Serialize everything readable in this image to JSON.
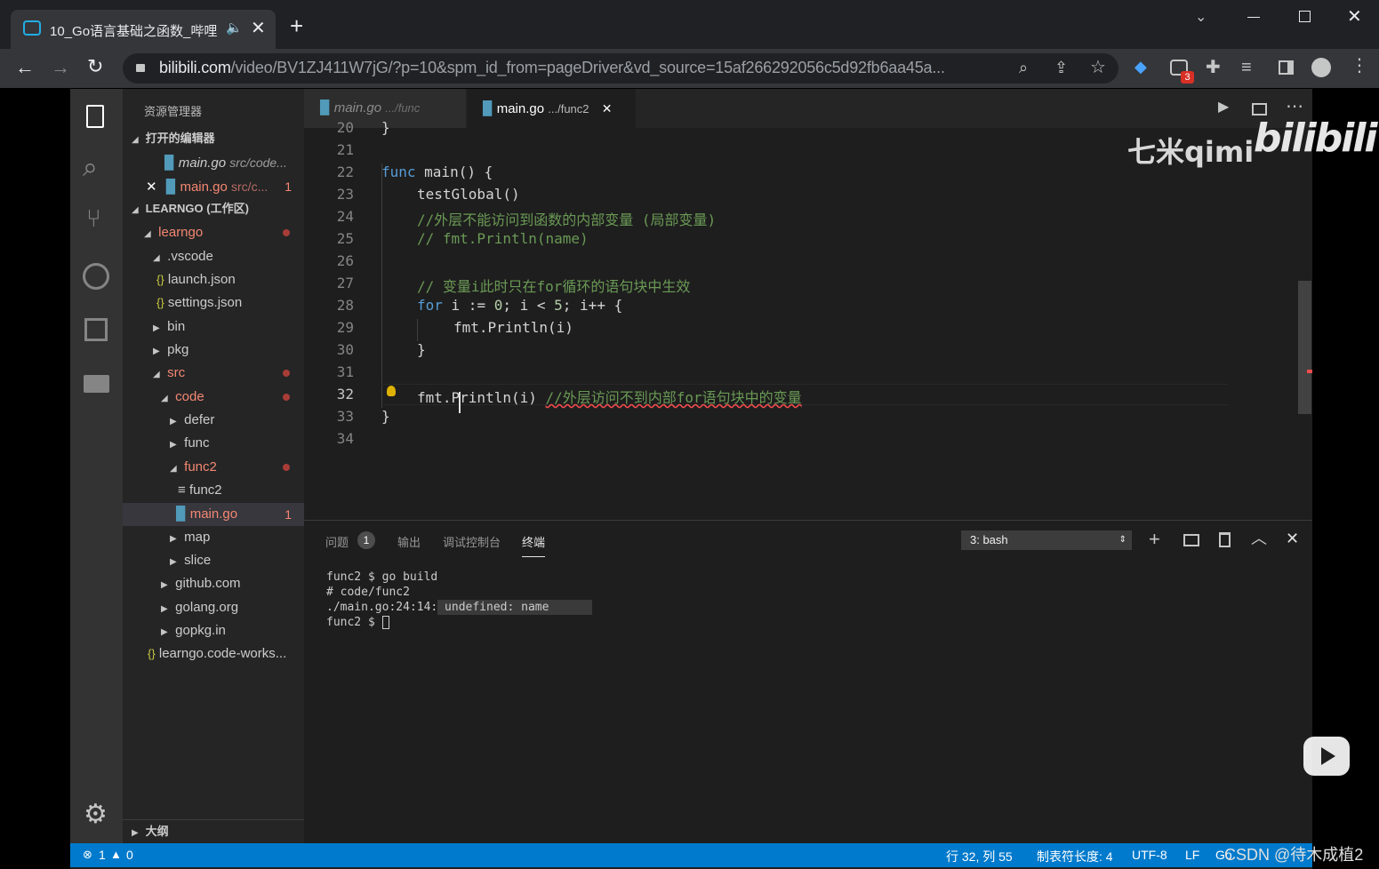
{
  "browser": {
    "tab_title": "10_Go语言基础之函数_哔哩",
    "new_tab": "+",
    "url_domain": "bilibili.com",
    "url_path": "/video/BV1ZJ411W7jG/?p=10&spm_id_from=pageDriver&vd_source=15af266292056c5d92fb6aa45a...",
    "extension_badge": "3"
  },
  "sidebar": {
    "title": "资源管理器",
    "open_editors_header": "打开的编辑器",
    "open_editors": [
      {
        "name": "main.go",
        "path": "src/code..."
      },
      {
        "name": "main.go",
        "path": "src/c...",
        "badge": "1"
      }
    ],
    "workspace_header": "LEARNGO (工作区)",
    "tree": [
      {
        "label": "learngo"
      },
      {
        "label": ".vscode"
      },
      {
        "label": "launch.json"
      },
      {
        "label": "settings.json"
      },
      {
        "label": "bin"
      },
      {
        "label": "pkg"
      },
      {
        "label": "src"
      },
      {
        "label": "code"
      },
      {
        "label": "defer"
      },
      {
        "label": "func"
      },
      {
        "label": "func2"
      },
      {
        "label": "func2"
      },
      {
        "label": "main.go",
        "badge": "1"
      },
      {
        "label": "map"
      },
      {
        "label": "slice"
      },
      {
        "label": "github.com"
      },
      {
        "label": "golang.org"
      },
      {
        "label": "gopkg.in"
      },
      {
        "label": "learngo.code-works..."
      }
    ],
    "outline_header": "大纲"
  },
  "editor_tabs": [
    {
      "name": "main.go",
      "path": ".../func"
    },
    {
      "name": "main.go",
      "path": ".../func2"
    }
  ],
  "line_numbers": [
    "20",
    "21",
    "22",
    "23",
    "24",
    "25",
    "26",
    "27",
    "28",
    "29",
    "30",
    "31",
    "32",
    "33",
    "34"
  ],
  "code": {
    "l20": "}",
    "l22_kw": "func",
    "l22_rest": " main() {",
    "l23": "testGlobal()",
    "l24": "//外层不能访问到函数的内部变量 (局部变量)",
    "l25": "// fmt.Println(name)",
    "l27": "// 变量i此时只在for循环的语句块中生效",
    "l28_kw": "for",
    "l28_a": " i := ",
    "l28_n1": "0",
    "l28_b": "; i < ",
    "l28_n2": "5",
    "l28_c": "; i++ {",
    "l29": "fmt.Println(i)",
    "l30": "}",
    "l32_code": "fmt.Println(i)",
    "l32_comment": "//外层访问不到内部for语句块中的变量",
    "l33": "}"
  },
  "watermark": {
    "author": "七米qimi",
    "site": "bilibili"
  },
  "panel": {
    "tabs": [
      "问题",
      "输出",
      "调试控制台",
      "终端"
    ],
    "problems_count": "1",
    "terminal_select": "3: bash",
    "terminal_lines": [
      "func2 $ go build",
      "# code/func2",
      "./main.go:24:14: undefined: name",
      "func2 $ "
    ]
  },
  "status": {
    "errors": "1",
    "warnings": "0",
    "position": "行 32, 列 55",
    "tab_size": "制表符长度: 4",
    "encoding": "UTF-8",
    "eol": "LF",
    "language": "Go",
    "csdn": "CSDN @待木成植2"
  },
  "colors": {
    "accent": "#007acc",
    "keyword": "#569cd6",
    "comment": "#6a9955",
    "error": "#f48771"
  }
}
